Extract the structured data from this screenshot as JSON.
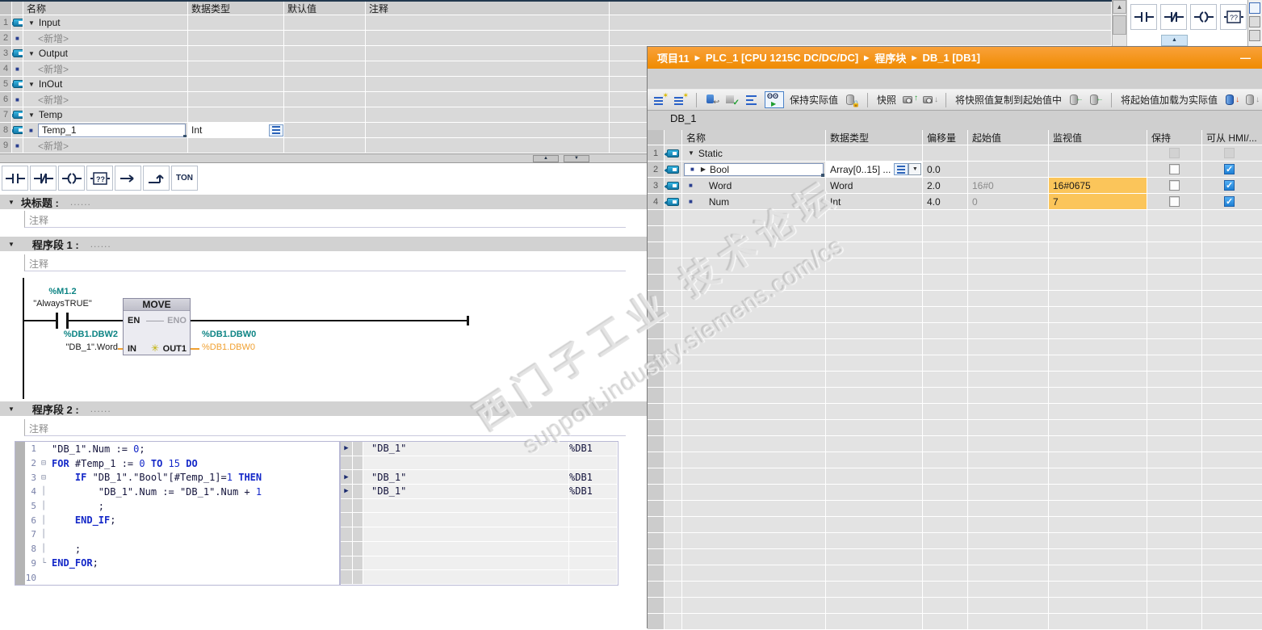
{
  "interface_table": {
    "columns": [
      "名称",
      "数据类型",
      "默认值",
      "注释"
    ],
    "rows": [
      {
        "num": "1",
        "name": "Input"
      },
      {
        "num": "2",
        "name": "<新增>"
      },
      {
        "num": "3",
        "name": "Output"
      },
      {
        "num": "4",
        "name": "<新增>"
      },
      {
        "num": "5",
        "name": "InOut"
      },
      {
        "num": "6",
        "name": "<新增>"
      },
      {
        "num": "7",
        "name": "Temp"
      },
      {
        "num": "8",
        "name": "Temp_1",
        "type": "Int"
      },
      {
        "num": "9",
        "name": "<新增>"
      }
    ]
  },
  "glyphs": {
    "expander_open": "▼",
    "expander_closed": "▶",
    "bullet": "■",
    "up": "▲",
    "down": "▼",
    "scroll_up": "▲",
    "dropdown": "▼",
    "ton": "TON"
  },
  "editor": {
    "block_title": {
      "label": "块标题 :",
      "dots": "......"
    },
    "comment_placeholder": "注释",
    "network1_label": "程序段 1 :",
    "network2_label": "程序段 2 :",
    "dots": "......"
  },
  "ladder": {
    "contact_address": "%M1.2",
    "contact_symbol": "\"AlwaysTRUE\"",
    "box_title": "MOVE",
    "pin_en": "EN",
    "pin_eno": "ENO",
    "pin_in": "IN",
    "pin_out": "OUT1",
    "in_address": "%DB1.DBW2",
    "in_symbol": "\"DB_1\".Word",
    "out_address": "%DB1.DBW0",
    "out_operand": "%DB1.DBW0",
    "spark": "✳"
  },
  "scl": {
    "lines": [
      {
        "n": "1",
        "fold": "",
        "segs": [
          {
            "c": "p",
            "t": "\"DB_1\".Num := "
          },
          {
            "c": "n",
            "t": "0"
          },
          {
            "c": "p",
            "t": ";"
          }
        ]
      },
      {
        "n": "2",
        "fold": "⊟",
        "segs": [
          {
            "c": "k",
            "t": "FOR"
          },
          {
            "c": "p",
            "t": " #Temp_1 := "
          },
          {
            "c": "n",
            "t": "0"
          },
          {
            "c": "p",
            "t": " "
          },
          {
            "c": "k",
            "t": "TO"
          },
          {
            "c": "p",
            "t": " "
          },
          {
            "c": "n",
            "t": "15"
          },
          {
            "c": "p",
            "t": " "
          },
          {
            "c": "k",
            "t": "DO"
          }
        ]
      },
      {
        "n": "3",
        "fold": "⊟",
        "segs": [
          {
            "c": "p",
            "t": "    "
          },
          {
            "c": "k",
            "t": "IF"
          },
          {
            "c": "p",
            "t": " \"DB_1\".\"Bool\"[#Temp_1]="
          },
          {
            "c": "n",
            "t": "1"
          },
          {
            "c": "p",
            "t": " "
          },
          {
            "c": "k",
            "t": "THEN"
          }
        ]
      },
      {
        "n": "4",
        "fold": "│",
        "segs": [
          {
            "c": "p",
            "t": "        \"DB_1\".Num := \"DB_1\".Num + "
          },
          {
            "c": "n",
            "t": "1"
          }
        ]
      },
      {
        "n": "5",
        "fold": "│",
        "segs": [
          {
            "c": "p",
            "t": "        ;"
          }
        ]
      },
      {
        "n": "6",
        "fold": "│",
        "segs": [
          {
            "c": "p",
            "t": "    "
          },
          {
            "c": "k",
            "t": "END_IF"
          },
          {
            "c": "p",
            "t": ";"
          }
        ]
      },
      {
        "n": "7",
        "fold": "│",
        "segs": []
      },
      {
        "n": "8",
        "fold": "│",
        "segs": [
          {
            "c": "p",
            "t": "    ;"
          }
        ]
      },
      {
        "n": "9",
        "fold": "└",
        "segs": [
          {
            "c": "k",
            "t": "END_FOR"
          },
          {
            "c": "p",
            "t": ";"
          }
        ]
      },
      {
        "n": "10",
        "fold": "",
        "segs": []
      }
    ],
    "side_rows": [
      {
        "arrow": "▶",
        "name": "\"DB_1\"",
        "addr": "%DB1"
      },
      {},
      {
        "arrow": "▶",
        "name": "\"DB_1\"",
        "addr": "%DB1"
      },
      {
        "arrow": "▶",
        "name": "\"DB_1\"",
        "addr": "%DB1"
      },
      {},
      {},
      {},
      {},
      {},
      {}
    ]
  },
  "db_window": {
    "breadcrumb": [
      "项目11",
      "PLC_1 [CPU 1215C DC/DC/DC]",
      "程序块",
      "DB_1 [DB1]"
    ],
    "minimize": "—",
    "toolbar": {
      "labels": [
        "保持实际值",
        "快照",
        "将快照值复制到起始值中",
        "将起始值加载为实际值"
      ]
    },
    "title": "DB_1",
    "table": {
      "columns": [
        "名称",
        "数据类型",
        "偏移量",
        "起始值",
        "监视值",
        "保持",
        "可从 HMI/..."
      ],
      "rows": [
        {
          "num": "1",
          "name": "Static",
          "type": "",
          "offset": "",
          "start": "",
          "monitor": ""
        },
        {
          "num": "2",
          "name": "Bool",
          "type": "Array[0..15] ...",
          "offset": "0.0",
          "start": "",
          "monitor": ""
        },
        {
          "num": "3",
          "name": "Word",
          "type": "Word",
          "offset": "2.0",
          "start": "16#0",
          "monitor": "16#0675"
        },
        {
          "num": "4",
          "name": "Num",
          "type": "Int",
          "offset": "4.0",
          "start": "0",
          "monitor": "7"
        }
      ]
    }
  },
  "watermark": {
    "line1": "西门子工业  技术论坛",
    "line2": "support.industry.siemens.com/cs"
  },
  "colors": {
    "title_orange": "#ef8b00",
    "monitor_value_bg": "#fbc55a",
    "operand_teal": "#0d8484",
    "operand_orange": "#f0a030",
    "keyword_blue": "#1428c8"
  }
}
